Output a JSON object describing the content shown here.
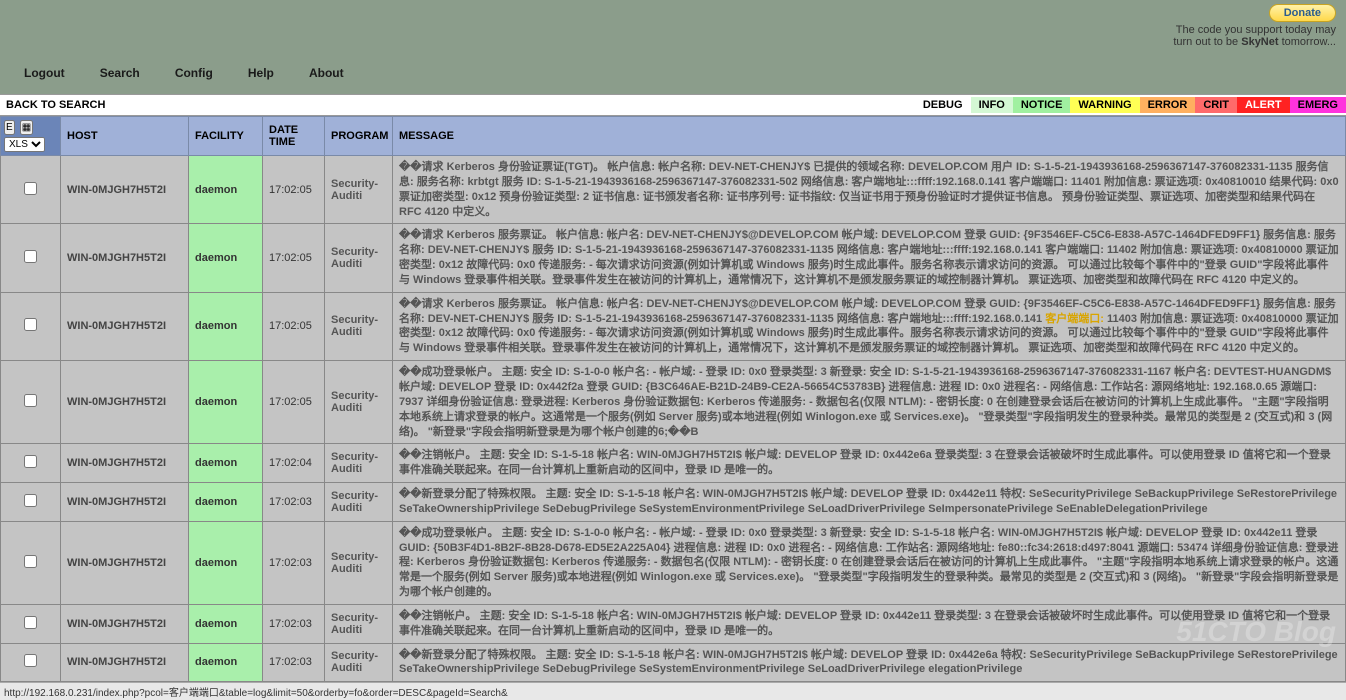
{
  "topbar": {
    "donate": "Donate",
    "tagline1": "The code you support today may",
    "tagline2a": "turn out to be ",
    "tagline2b": "SkyNet",
    "tagline2c": " tomorrow..."
  },
  "menu": {
    "logout": "Logout",
    "search": "Search",
    "config": "Config",
    "help": "Help",
    "about": "About"
  },
  "subbar": {
    "back": "BACK TO SEARCH"
  },
  "severity": {
    "debug": "DEBUG",
    "info": "INFO",
    "notice": "NOTICE",
    "warning": "WARNING",
    "error": "ERROR",
    "crit": "CRIT",
    "alert": "ALERT",
    "emerg": "EMERG"
  },
  "controls": {
    "e_btn": "E",
    "export": "XLS"
  },
  "headers": {
    "host": "HOST",
    "facility": "FACILITY",
    "datetime": "DATE TIME",
    "program": "PROGRAM",
    "message": "MESSAGE"
  },
  "rows": [
    {
      "host": "WIN-0MJGH7H5T2I",
      "facility": "daemon",
      "time": "17:02:05",
      "program": "Security-Auditi",
      "message": "��请求 Kerberos 身份验证票证(TGT)。 帐户信息: 帐户名称: DEV-NET-CHENJY$ 已提供的领域名称: DEVELOP.COM 用户 ID: S-1-5-21-1943936168-2596367147-376082331-1135 服务信息: 服务名称: krbtgt 服务 ID: S-1-5-21-1943936168-2596367147-376082331-502 网络信息: 客户端地址:::ffff:192.168.0.141 客户端端口: 11401 附加信息: 票证选项: 0x40810010 结果代码: 0x0 票证加密类型: 0x12 预身份验证类型: 2 证书信息: 证书颁发者名称: 证书序列号: 证书指纹: 仅当证书用于预身份验证时才提供证书信息。 预身份验证类型、票证选项、加密类型和结果代码在 RFC 4120 中定义。"
    },
    {
      "host": "WIN-0MJGH7H5T2I",
      "facility": "daemon",
      "time": "17:02:05",
      "program": "Security-Auditi",
      "message": "��请求 Kerberos 服务票证。 帐户信息: 帐户名: DEV-NET-CHENJY$@DEVELOP.COM 帐户域: DEVELOP.COM 登录 GUID: {9F3546EF-C5C6-E838-A57C-1464DFED9FF1} 服务信息: 服务名称: DEV-NET-CHENJY$ 服务 ID: S-1-5-21-1943936168-2596367147-376082331-1135 网络信息: 客户端地址:::ffff:192.168.0.141 客户端端口: 11402 附加信息: 票证选项: 0x40810000 票证加密类型: 0x12 故障代码: 0x0 传递服务: - 每次请求访问资源(例如计算机或 Windows 服务)时生成此事件。服务名称表示请求访问的资源。 可以通过比较每个事件中的\"登录 GUID\"字段将此事件与 Windows 登录事件相关联。登录事件发生在被访问的计算机上，通常情况下，这计算机不是颁发服务票证的域控制器计算机。 票证选项、加密类型和故障代码在 RFC 4120 中定义的。"
    },
    {
      "host": "WIN-0MJGH7H5T2I",
      "facility": "daemon",
      "time": "17:02:05",
      "program": "Security-Auditi",
      "message_pre": "��请求 Kerberos 服务票证。 帐户信息: 帐户名: DEV-NET-CHENJY$@DEVELOP.COM 帐户域: DEVELOP.COM 登录 GUID: {9F3546EF-C5C6-E838-A57C-1464DFED9FF1} 服务信息: 服务名称: DEV-NET-CHENJY$ 服务 ID: S-1-5-21-1943936168-2596367147-376082331-1135 网络信息: 客户端地址:::ffff:192.168.0.141 ",
      "message_hl": "客户端端口:",
      "message_post": " 11403 附加信息: 票证选项: 0x40810000 票证加密类型: 0x12 故障代码: 0x0 传递服务: - 每次请求访问资源(例如计算机或 Windows 服务)时生成此事件。服务名称表示请求访问的资源。 可以通过比较每个事件中的\"登录 GUID\"字段将此事件与 Windows 登录事件相关联。登录事件发生在被访问的计算机上，通常情况下，这计算机不是颁发服务票证的域控制器计算机。 票证选项、加密类型和故障代码在 RFC 4120 中定义的。"
    },
    {
      "host": "WIN-0MJGH7H5T2I",
      "facility": "daemon",
      "time": "17:02:05",
      "program": "Security-Auditi",
      "message": "��成功登录帐户。 主题: 安全 ID: S-1-0-0 帐户名: - 帐户域: - 登录 ID: 0x0 登录类型: 3 新登录: 安全 ID: S-1-5-21-1943936168-2596367147-376082331-1167 帐户名: DEVTEST-HUANGDM$ 帐户域: DEVELOP 登录 ID: 0x442f2a 登录 GUID: {B3C646AE-B21D-24B9-CE2A-56654C53783B} 进程信息: 进程 ID: 0x0 进程名: - 网络信息: 工作站名: 源网络地址: 192.168.0.65 源端口: 7937 详细身份验证信息: 登录进程: Kerberos 身份验证数据包: Kerberos 传递服务: - 数据包名(仅限 NTLM): - 密钥长度: 0 在创建登录会话后在被访问的计算机上生成此事件。 \"主题\"字段指明本地系统上请求登录的帐户。这通常是一个服务(例如 Server 服务)或本地进程(例如 Winlogon.exe 或 Services.exe)。 \"登录类型\"字段指明发生的登录种类。最常见的类型是 2 (交互式)和 3 (网络)。 \"新登录\"字段会指明新登录是为哪个帐户创建的6;��B"
    },
    {
      "host": "WIN-0MJGH7H5T2I",
      "facility": "daemon",
      "time": "17:02:04",
      "program": "Security-Auditi",
      "message": "��注销帐户。 主题: 安全 ID: S-1-5-18 帐户名: WIN-0MJGH7H5T2I$ 帐户域: DEVELOP 登录 ID: 0x442e6a 登录类型: 3 在登录会话被破坏时生成此事件。可以使用登录 ID 值将它和一个登录事件准确关联起来。在同一台计算机上重新启动的区间中，登录 ID 是唯一的。"
    },
    {
      "host": "WIN-0MJGH7H5T2I",
      "facility": "daemon",
      "time": "17:02:03",
      "program": "Security-Auditi",
      "message": "��新登录分配了特殊权限。 主题: 安全 ID: S-1-5-18 帐户名: WIN-0MJGH7H5T2I$ 帐户域: DEVELOP 登录 ID: 0x442e11 特权: SeSecurityPrivilege SeBackupPrivilege SeRestorePrivilege SeTakeOwnershipPrivilege SeDebugPrivilege SeSystemEnvironmentPrivilege SeLoadDriverPrivilege SeImpersonatePrivilege SeEnableDelegationPrivilege"
    },
    {
      "host": "WIN-0MJGH7H5T2I",
      "facility": "daemon",
      "time": "17:02:03",
      "program": "Security-Auditi",
      "message": "��成功登录帐户。 主题: 安全 ID: S-1-0-0 帐户名: - 帐户域: - 登录 ID: 0x0 登录类型: 3 新登录: 安全 ID: S-1-5-18 帐户名: WIN-0MJGH7H5T2I$ 帐户域: DEVELOP 登录 ID: 0x442e11 登录 GUID: {50B3F4D1-8B2F-8B28-D678-ED5E2A225A04} 进程信息: 进程 ID: 0x0 进程名: - 网络信息: 工作站名: 源网络地址: fe80::fc34:2618:d497:8041 源端口: 53474 详细身份验证信息: 登录进程: Kerberos 身份验证数据包: Kerberos 传递服务: - 数据包名(仅限 NTLM): - 密钥长度: 0 在创建登录会话后在被访问的计算机上生成此事件。 \"主题\"字段指明本地系统上请求登录的帐户。这通常是一个服务(例如 Server 服务)或本地进程(例如 Winlogon.exe 或 Services.exe)。 \"登录类型\"字段指明发生的登录种类。最常见的类型是 2 (交互式)和 3 (网络)。 \"新登录\"字段会指明新登录是为哪个帐户创建的。"
    },
    {
      "host": "WIN-0MJGH7H5T2I",
      "facility": "daemon",
      "time": "17:02:03",
      "program": "Security-Auditi",
      "message": "��注销帐户。 主题: 安全 ID: S-1-5-18 帐户名: WIN-0MJGH7H5T2I$ 帐户域: DEVELOP 登录 ID: 0x442e11 登录类型: 3 在登录会话被破坏时生成此事件。可以使用登录 ID 值将它和一个登录事件准确关联起来。在同一台计算机上重新启动的区间中，登录 ID 是唯一的。"
    },
    {
      "host": "WIN-0MJGH7H5T2I",
      "facility": "daemon",
      "time": "17:02:03",
      "program": "Security-Auditi",
      "message": "��新登录分配了特殊权限。 主题: 安全 ID: S-1-5-18 帐户名: WIN-0MJGH7H5T2I$ 帐户域: DEVELOP 登录 ID: 0x442e6a 特权: SeSecurityPrivilege SeBackupPrivilege SeRestorePrivilege SeTakeOwnershipPrivilege SeDebugPrivilege SeSystemEnvironmentPrivilege SeLoadDriverPrivilege elegationPrivilege"
    }
  ],
  "status": "http://192.168.0.231/index.php?pcol=客户端端口&table=log&limit=50&orderby=fo&order=DESC&pageId=Search&"
}
